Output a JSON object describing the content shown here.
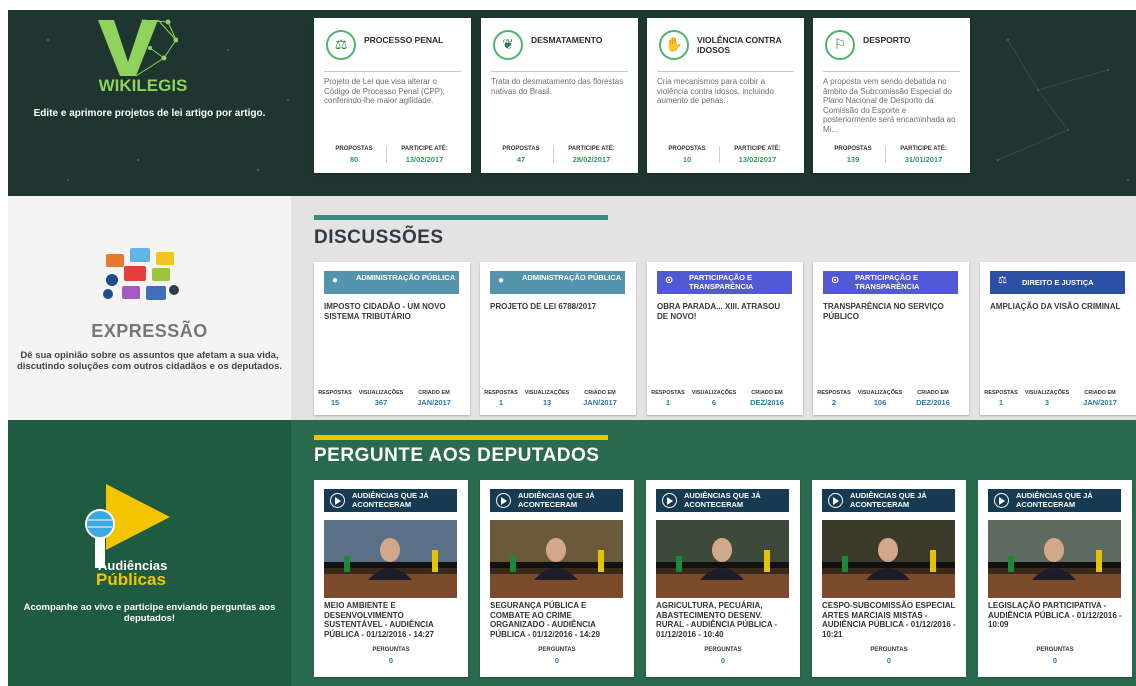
{
  "wikilegis": {
    "brand": "WIKILEGIS",
    "description": "Edite e aprimore projetos de lei artigo por artigo.",
    "cards": [
      {
        "title": "PROCESSO PENAL",
        "icon": "scales-icon",
        "desc": "Projeto de Lei que visa alterar o Código de Processo Penal (CPP), conferindo-lhe maior agilidade.",
        "propostas_label": "PROPOSTAS",
        "propostas": "80",
        "ate_label": "PARTICIPE ATÉ:",
        "ate": "13/02/2017"
      },
      {
        "title": "DESMATAMENTO",
        "icon": "leaf-icon",
        "desc": "Trata do desmatamento das florestas nativas do Brasil.",
        "propostas_label": "PROPOSTAS",
        "propostas": "47",
        "ate_label": "PARTICIPE ATÉ:",
        "ate": "28/02/2017"
      },
      {
        "title": "VIOLÊNCIA CONTRA IDOSOS",
        "icon": "stop-hand-icon",
        "desc": "Cria mecanismos para coibir a violência contra idosos, incluindo aumento de penas.",
        "propostas_label": "PROPOSTAS",
        "propostas": "10",
        "ate_label": "PARTICIPE ATÉ:",
        "ate": "13/02/2017"
      },
      {
        "title": "DESPORTO",
        "icon": "runner-icon",
        "desc": "A proposta vem sendo debatida no âmbito da Subcomissão Especial do Plano Nacional de Desporto da Comissão do Esporte e posteriormente será encaminhada ao Mi...",
        "propostas_label": "PROPOSTAS",
        "propostas": "139",
        "ate_label": "PARTICIPE ATÉ:",
        "ate": "31/01/2017"
      }
    ]
  },
  "expressao": {
    "brand": "EXPRESSÃO",
    "description": "Dê sua opinião sobre os assuntos que afetam a sua vida, discutindo soluções com outros cidadãos e os deputados.",
    "section_title": "DISCUSSÕES",
    "cards": [
      {
        "tag": "ADMINISTRAÇÃO PÚBLICA",
        "tag_color": "#5494ad",
        "icon": "person-icon",
        "title": "IMPOSTO CIDADÃO - UM NOVO SISTEMA TRIBUTÁRIO",
        "l1": "RESPOSTAS",
        "v1": "15",
        "l2": "VISUALIZAÇÕES",
        "v2": "367",
        "l3": "CRIADO EM",
        "v3": "JAN/2017"
      },
      {
        "tag": "ADMINISTRAÇÃO PÚBLICA",
        "tag_color": "#5494ad",
        "icon": "person-icon",
        "title": "PROJETO DE LEI 6788/2017",
        "l1": "RESPOSTAS",
        "v1": "1",
        "l2": "VISUALIZAÇÕES",
        "v2": "13",
        "l3": "CRIADO EM",
        "v3": "JAN/2017"
      },
      {
        "tag": "PARTICIPAÇÃO E TRANSPARÊNCIA",
        "tag_color": "#5259d6",
        "icon": "search-icon",
        "title": "OBRA PARADA... XIII. ATRASOU DE NOVO!",
        "l1": "RESPOSTAS",
        "v1": "1",
        "l2": "VISUALIZAÇÕES",
        "v2": "6",
        "l3": "CRIADO EM",
        "v3": "DEZ/2016"
      },
      {
        "tag": "PARTICIPAÇÃO E TRANSPARÊNCIA",
        "tag_color": "#5259d6",
        "icon": "search-icon",
        "title": "TRANSPARÊNCIA NO SERVIÇO PÚBLICO",
        "l1": "RESPOSTAS",
        "v1": "2",
        "l2": "VISUALIZAÇÕES",
        "v2": "106",
        "l3": "CRIADO EM",
        "v3": "DEZ/2016"
      },
      {
        "tag": "DIREITO E JUSTIÇA",
        "tag_color": "#2a4fa5",
        "icon": "scales-icon",
        "title": "AMPLIAÇÃO DA VISÃO CRIMINAL",
        "l1": "RESPOSTAS",
        "v1": "1",
        "l2": "VISUALIZAÇÕES",
        "v2": "3",
        "l3": "CRIADO EM",
        "v3": "JAN/2017"
      }
    ]
  },
  "audiencias": {
    "brand_line1": "Audiências",
    "brand_line2": "Públicas",
    "description": "Acompanhe ao vivo e participe enviando perguntas aos deputados!",
    "section_title": "PERGUNTE AOS DEPUTADOS",
    "cards": [
      {
        "tag": "AUDIÊNCIAS QUE JÁ ACONTECERAM",
        "title": "MEIO AMBIENTE E DESENVOLVIMENTO SUSTENTÁVEL - AUDIÊNCIA PÚBLICA - 01/12/2016 - 14:27",
        "q_label": "PERGUNTAS",
        "q": "0"
      },
      {
        "tag": "AUDIÊNCIAS QUE JÁ ACONTECERAM",
        "title": "SEGURANÇA PÚBLICA E COMBATE AO CRIME ORGANIZADO - AUDIÊNCIA PÚBLICA - 01/12/2016 - 14:29",
        "q_label": "PERGUNTAS",
        "q": "0"
      },
      {
        "tag": "AUDIÊNCIAS QUE JÁ ACONTECERAM",
        "title": "AGRICULTURA, PECUÁRIA, ABASTECIMENTO DESENV. RURAL - AUDIÊNCIA PÚBLICA - 01/12/2016 - 10:40",
        "q_label": "PERGUNTAS",
        "q": "0"
      },
      {
        "tag": "AUDIÊNCIAS QUE JÁ ACONTECERAM",
        "title": "CESPO-SUBCOMISSÃO ESPECIAL ARTES MARCIAIS MISTAS - AUDIÊNCIA PÚBLICA - 01/12/2016 - 10:21",
        "q_label": "PERGUNTAS",
        "q": "0"
      },
      {
        "tag": "AUDIÊNCIAS QUE JÁ ACONTECERAM",
        "title": "LEGISLAÇÃO PARTICIPATIVA - AUDIÊNCIA PÚBLICA - 01/12/2016 - 10:09",
        "q_label": "PERGUNTAS",
        "q": "0"
      }
    ]
  }
}
